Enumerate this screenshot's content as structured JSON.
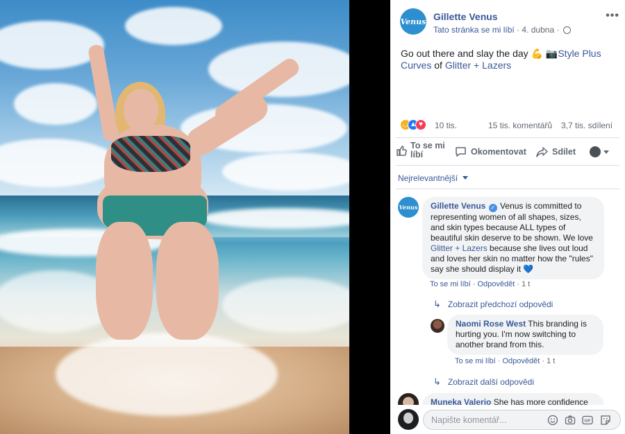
{
  "post": {
    "page_name": "Gillette Venus",
    "logo_text": "Venus",
    "like_page": "Tato stránka se mi líbí",
    "date": "4. dubna",
    "text_before": "Go out there and slay the day",
    "emoji_flex": "💪",
    "emoji_camera": "📷",
    "link1": "Style Plus Curves",
    "text_of": "of",
    "link2": "Glitter + Lazers"
  },
  "reactions": {
    "count": "10 tis.",
    "comments": "15 tis. komentářů",
    "shares": "3,7 tis. sdílení"
  },
  "actions": {
    "like": "To se mi líbí",
    "comment": "Okomentovat",
    "share": "Sdílet"
  },
  "sort_label": "Nejrelevantnější",
  "comments": [
    {
      "author": "Gillette Venus",
      "verified": true,
      "text_a": "Venus is committed to representing women of all shapes, sizes, and skin types because ALL types of beautiful skin deserve to be shown. We love",
      "link": "Glitter + Lazers",
      "text_b": "because she lives out loud and loves her skin no matter how the \"rules\" say she should display it",
      "heart": "💙",
      "like": "To se mi líbí",
      "reply": "Odpovědět",
      "time": "1 t"
    },
    {
      "author": "Naomi Rose West",
      "text": "This branding is hurting you. I'm now switching to another brand from this.",
      "like": "To se mi líbí",
      "reply": "Odpovědět",
      "time": "1 t"
    },
    {
      "author": "Muneka Valerio",
      "text": "She has more confidence"
    }
  ],
  "show_previous": "Zobrazit předchozí odpovědi",
  "show_more": "Zobrazit další odpovědi",
  "composer": {
    "placeholder": "Napište komentář...",
    "icons": [
      "emoji-icon",
      "camera-icon",
      "gif-icon",
      "sticker-icon"
    ]
  },
  "colors": {
    "link_blue": "#385898",
    "venus_blue": "#2d8fd0",
    "bubble_bg": "#f2f3f5"
  }
}
